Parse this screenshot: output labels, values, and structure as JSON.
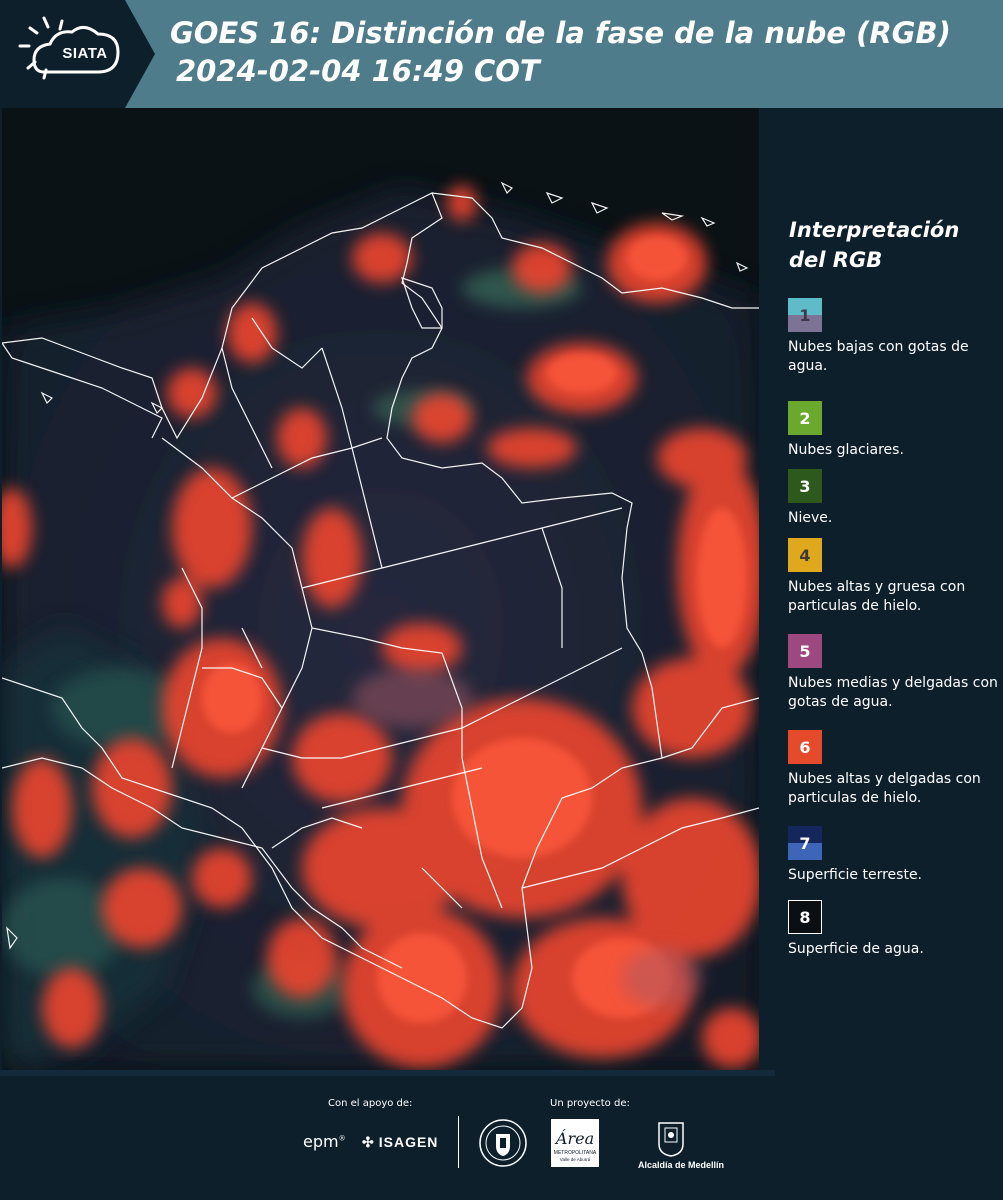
{
  "header": {
    "logo_text": "SIATA",
    "title_line1": "GOES 16: Distinción de la fase de la nube (RGB)",
    "title_line2": "2024-02-04 16:49 COT",
    "background_color": "#4e7c8b"
  },
  "map": {
    "description_colors": {
      "cloud_red": "#e8452e",
      "land_dark": "#1b2c3a",
      "ocean": "#0a1216"
    }
  },
  "legend": {
    "title": "Interpretación del RGB",
    "items": [
      {
        "number": "1",
        "label": "Nubes bajas con gotas de agua.",
        "color_top": "#5ebbc8",
        "color_bottom": "#7d7395",
        "num_color": "#3a3a4a"
      },
      {
        "number": "2",
        "label": "Nubes glaciares.",
        "color_top": "#6aa82e",
        "color_bottom": "#6aa82e",
        "num_color": "#ffffff"
      },
      {
        "number": "3",
        "label": "Nieve.",
        "color_top": "#2d5a1c",
        "color_bottom": "#2d5a1c",
        "num_color": "#ffffff"
      },
      {
        "number": "4",
        "label": "Nubes altas y gruesa con particulas de hielo.",
        "color_top": "#e0a81c",
        "color_bottom": "#e0a81c",
        "num_color": "#3a3a3a"
      },
      {
        "number": "5",
        "label": "Nubes medias y delgadas con gotas de agua.",
        "color_top": "#9e4880",
        "color_bottom": "#9e4880",
        "num_color": "#ffffff"
      },
      {
        "number": "6",
        "label": "Nubes altas y delgadas con particulas de hielo.",
        "color_top": "#e54b2b",
        "color_bottom": "#e54b2b",
        "num_color": "#ffffff"
      },
      {
        "number": "7",
        "label": "Superficie terreste.",
        "color_top": "#14265c",
        "color_bottom": "#3e66b8",
        "num_color": "#ffffff"
      },
      {
        "number": "8",
        "label": "Superficie de agua.",
        "color_top": "#0a0f14",
        "color_bottom": "#0a0f14",
        "num_color": "#ffffff"
      }
    ]
  },
  "footer": {
    "support_label": "Con el apoyo de:",
    "project_label": "Un proyecto de:",
    "sponsor_epm": "epm",
    "sponsor_isagen": "ISAGEN",
    "area_logo_text": "Área",
    "area_sub1": "METROPOLITANA",
    "area_sub2": "Valle de Aburrá",
    "alcaldia": "Alcaldía de Medellín"
  }
}
